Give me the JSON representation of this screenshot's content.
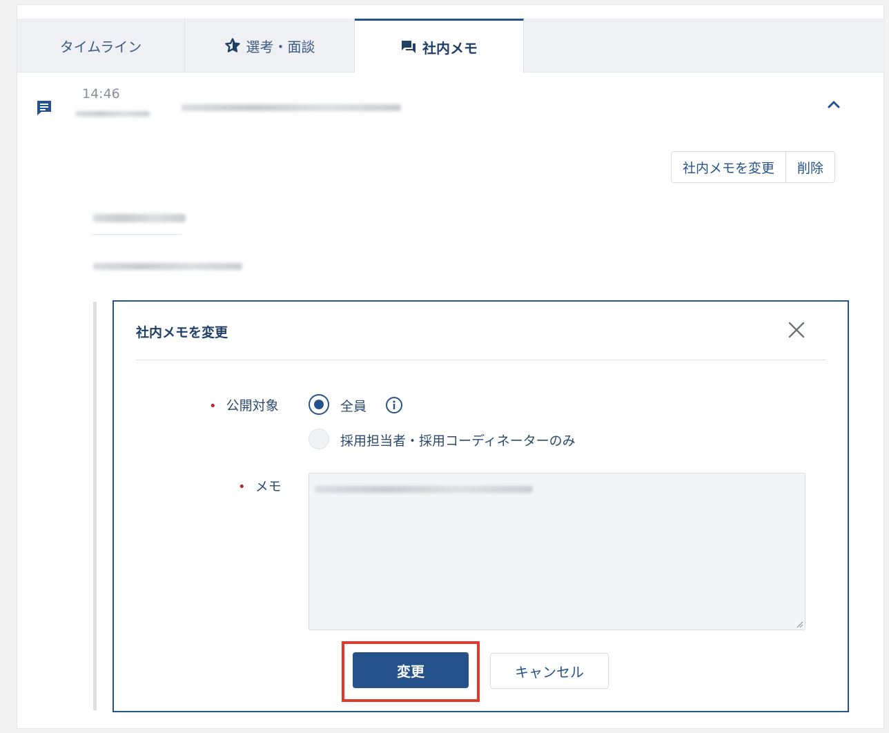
{
  "tabs": [
    {
      "label": "タイムライン",
      "icon": ""
    },
    {
      "label": "選考・面談",
      "icon": "star-outline-icon"
    },
    {
      "label": "社内メモ",
      "icon": "chat-bubbles-icon",
      "active": true
    }
  ],
  "memo_entry": {
    "time": "14:46",
    "edit_button": "社内メモを変更",
    "delete_button": "削除"
  },
  "edit_panel": {
    "title": "社内メモを変更",
    "visibility_label": "公開対象",
    "option_all": "全員",
    "option_recruiters": "採用担当者・採用コーディネーターのみ",
    "memo_label": "メモ",
    "submit_label": "変更",
    "cancel_label": "キャンセル"
  },
  "colors": {
    "primary": "#25528a",
    "required": "#b52a2a",
    "highlight": "#e03a2f"
  }
}
